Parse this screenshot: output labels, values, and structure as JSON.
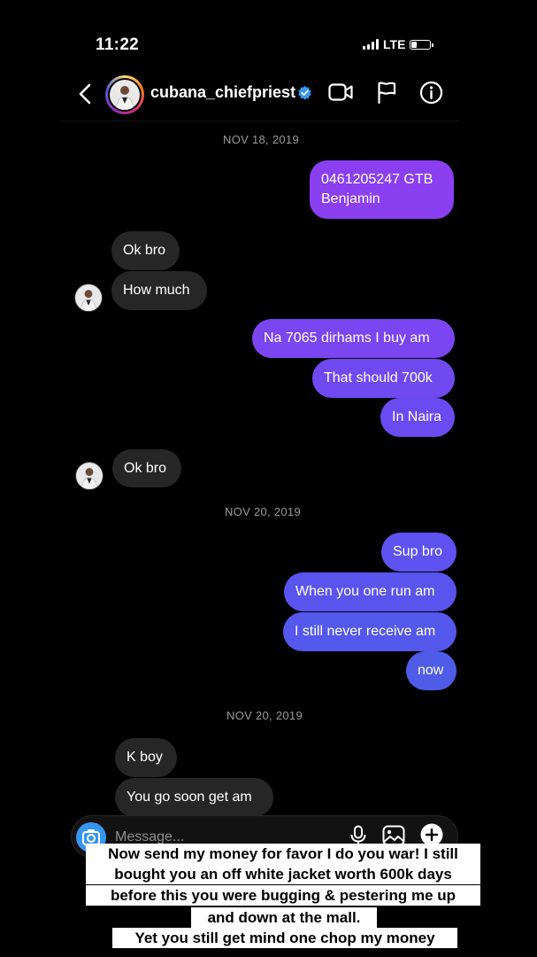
{
  "status_bar": {
    "time": "11:22",
    "network": "LTE"
  },
  "header": {
    "username": "cubana_chiefpriest"
  },
  "colors": {
    "purple": "#8a3ff0",
    "violet": "#6a4bf2",
    "blue": "#4f5ce8",
    "incoming": "#262626",
    "verified": "#3797f0"
  },
  "conversation": {
    "date_1": "NOV 18, 2019",
    "msg_1": "0461205247 GTB",
    "msg_1b": "Benjamin",
    "msg_2": "Ok bro",
    "msg_3": "How much",
    "msg_4": "Na 7065 dirhams I buy am",
    "msg_5": "That should 700k",
    "msg_6": "In Naira",
    "msg_7": "Ok bro",
    "date_2": "NOV 20, 2019",
    "msg_8": "Sup bro",
    "msg_9": "When you one run am",
    "msg_10": "I still never receive am",
    "msg_11": "now",
    "date_3": "NOV 20, 2019",
    "msg_12": "K boy",
    "msg_13": "You go soon get am"
  },
  "composer": {
    "placeholder": "Message..."
  },
  "caption": {
    "line_1": "Now send my money for favor I do you war! I still",
    "line_2": "bought you an off white jacket worth 600k days",
    "line_3": "before this you were bugging & pestering me up",
    "line_4": "and down at the mall.",
    "line_5": "Yet you still get mind one chop my money"
  }
}
